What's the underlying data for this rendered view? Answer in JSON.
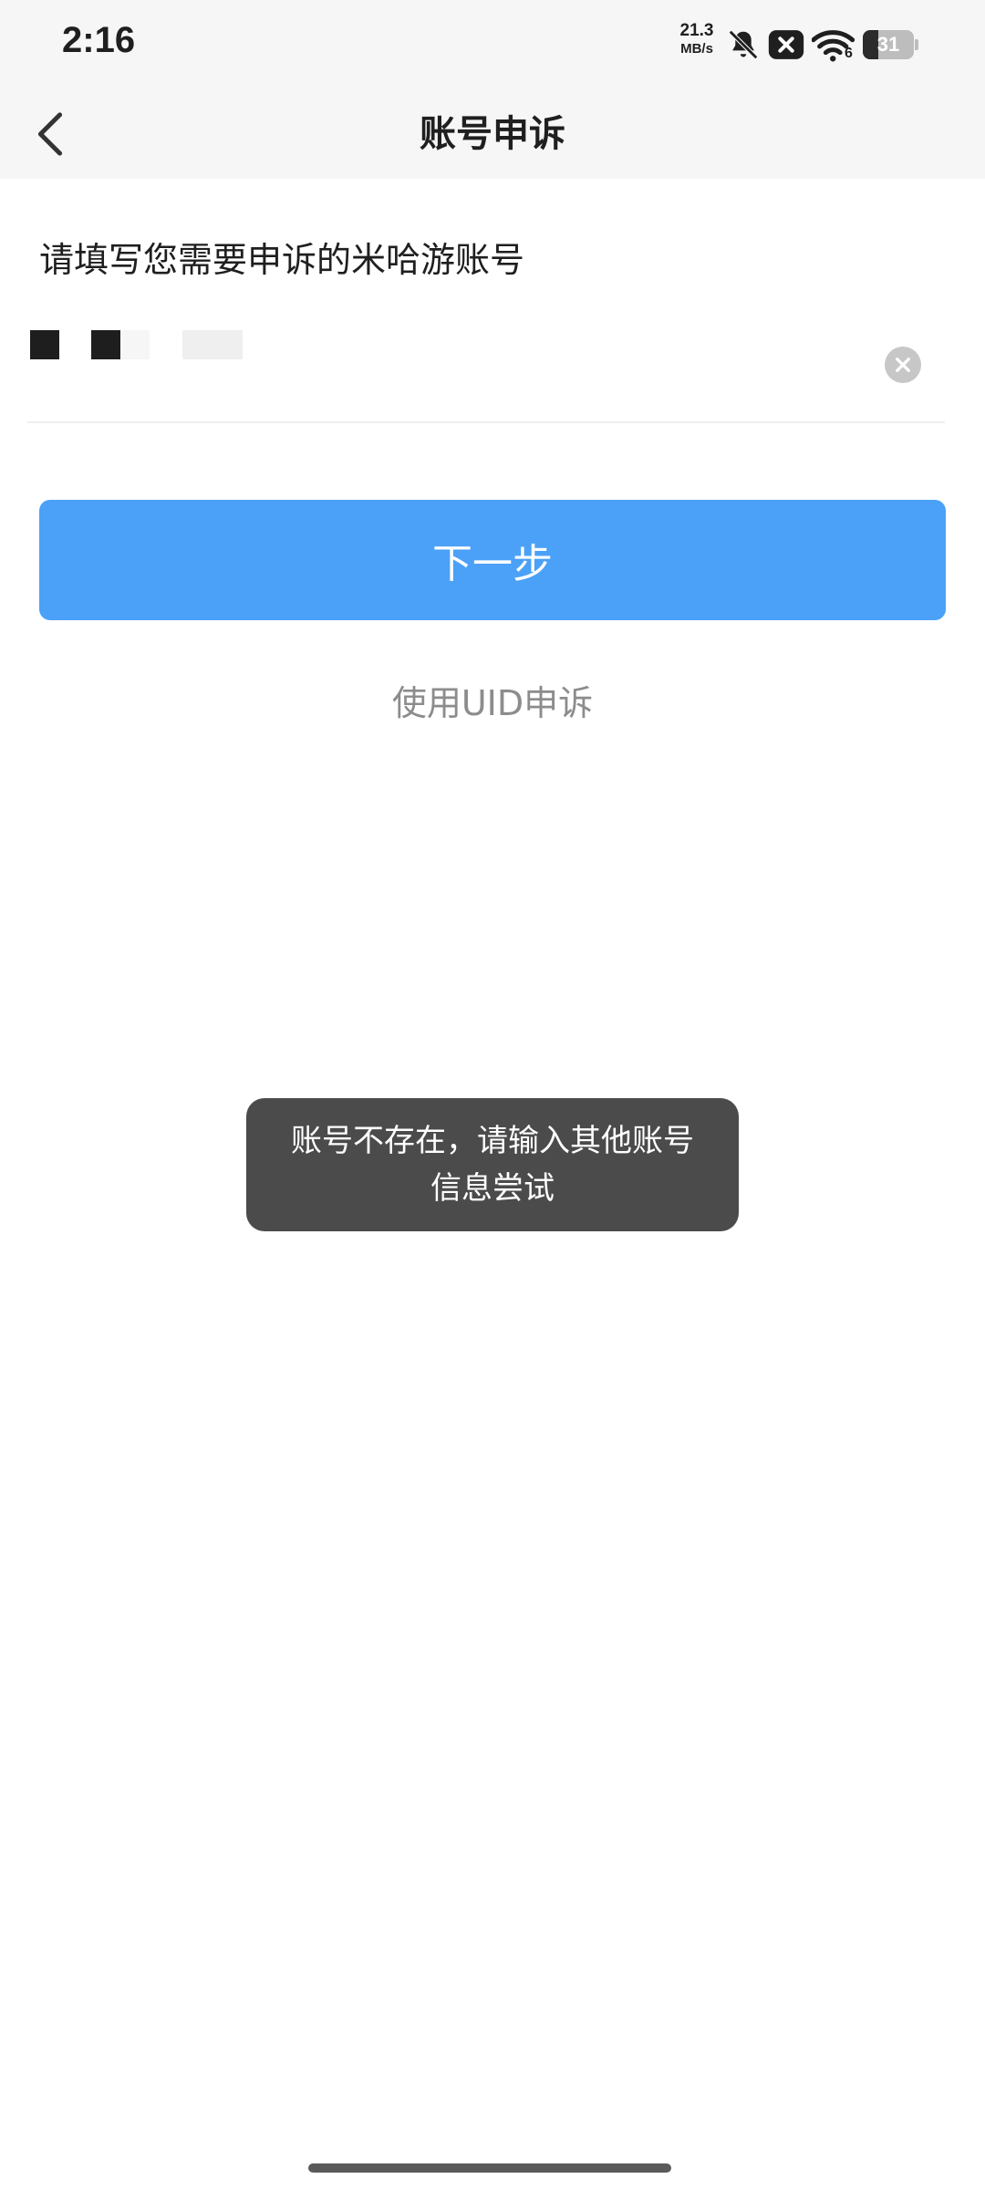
{
  "status_bar": {
    "time": "2:16",
    "net_speed_value": "21.3",
    "net_speed_unit": "MB/s",
    "wifi_label": "6",
    "battery_level": "31",
    "battery_fraction": 0.31,
    "icons": [
      "bell-off-icon",
      "close-box-icon",
      "wifi-icon",
      "battery-icon"
    ]
  },
  "nav": {
    "title": "账号申诉",
    "back_icon": "back-arrow-icon"
  },
  "form": {
    "prompt": "请填写您需要申诉的米哈游账号",
    "clear_icon": "clear-icon"
  },
  "actions": {
    "next_label": "下一步",
    "uid_link": "使用UID申诉"
  },
  "toast": {
    "message": "账号不存在，请输入其他账号信息尝试"
  },
  "colors": {
    "primary_button": "#4ba1f7",
    "toast_bg": "#4b4b4b",
    "link_gray": "#8c8c8c",
    "bar_bg": "#f6f6f6"
  }
}
